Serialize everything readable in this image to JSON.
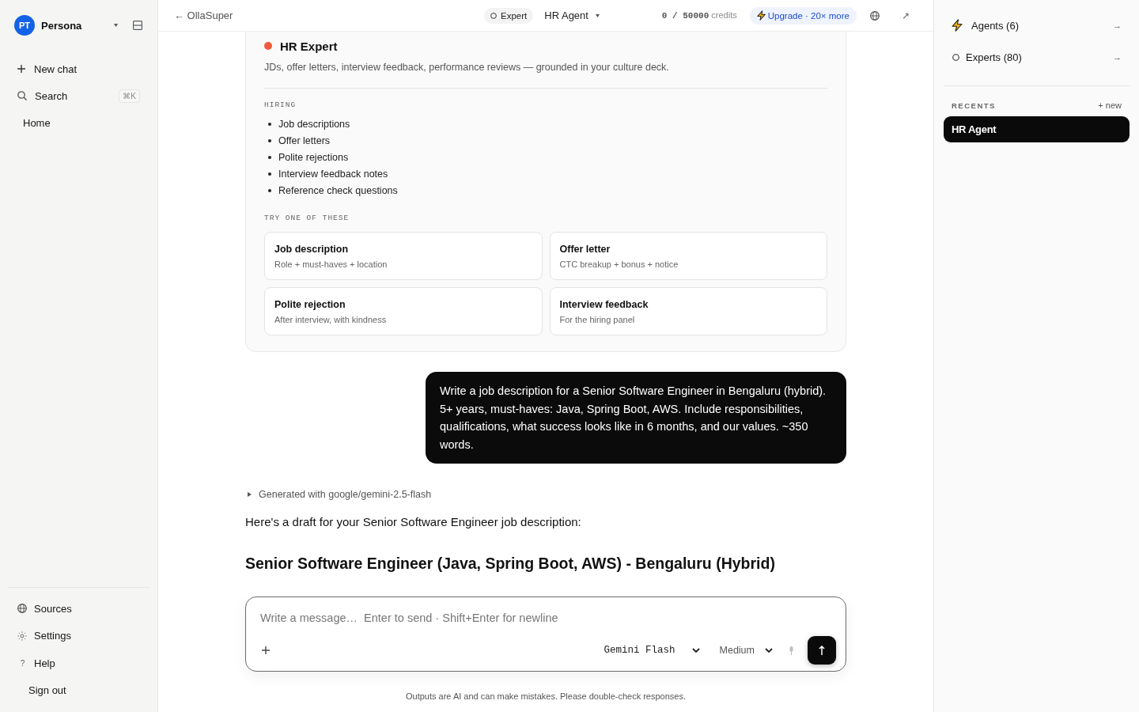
{
  "sidebar": {
    "account": {
      "initials": "PT",
      "name": "Persona"
    },
    "nav": [
      {
        "kind": "new",
        "label": "New chat"
      },
      {
        "kind": "search",
        "label": "Search",
        "shortcut": "⌘K"
      },
      {
        "kind": "link",
        "label": "Home"
      }
    ],
    "footer_nav": [
      {
        "kind": "sources",
        "label": "Sources"
      },
      {
        "kind": "settings",
        "label": "Settings"
      },
      {
        "kind": "help",
        "glyph": "?",
        "label": "Help"
      },
      {
        "kind": "link",
        "label": "Sign out"
      }
    ]
  },
  "top_bar": {
    "back_link": {
      "arrow": "←",
      "label": "OllaSuper"
    },
    "mode": {
      "label": "Expert"
    },
    "agent_select": {
      "label": "HR Agent"
    },
    "credits": {
      "amount": "0 / 50000",
      "unit": "credits"
    },
    "upgrade_button": {
      "label": "Upgrade · 20× more"
    },
    "open_button": {
      "glyph": "↗"
    }
  },
  "expert_card": {
    "name": "HR Expert",
    "description": "JDs, offer letters, interview feedback, performance reviews — grounded in your culture deck.",
    "sections": [
      {
        "heading": "HIRING",
        "items": [
          "Job descriptions",
          "Offer letters",
          "Polite rejections",
          "Interview feedback notes",
          "Reference check questions"
        ]
      }
    ],
    "suggestions_heading": "TRY ONE OF THESE",
    "suggestions": [
      {
        "title": "Job description",
        "subtitle": "Role + must-haves + location"
      },
      {
        "title": "Offer letter",
        "subtitle": "CTC breakup + bonus + notice"
      },
      {
        "title": "Polite rejection",
        "subtitle": "After interview, with kindness"
      },
      {
        "title": "Interview feedback",
        "subtitle": "For the hiring panel"
      }
    ]
  },
  "messages": [
    {
      "kind": "user",
      "text": "Write a job description for a Senior Software Engineer in Bengaluru (hybrid). 5+ years, must-haves: Java, Spring Boot, AWS. Include responsibilities, qualifications, what success looks like in 6 months, and our values. ~350 words."
    },
    {
      "kind": "assistant",
      "meta": "Generated with google/gemini-2.5-flash",
      "expanded": false,
      "intro": "Here's a draft for your Senior Software Engineer job description:",
      "heading": "Senior Software Engineer (Java, Spring Boot, AWS) - Bengaluru (Hybrid)"
    }
  ],
  "composer": {
    "placeholder": "Write a message…  Enter to send · Shift+Enter for newline",
    "model_select": {
      "value": "Gemini Flash"
    },
    "effort_select": {
      "value": "Medium"
    }
  },
  "disclaimer": "Outputs are AI and can make mistakes. Please double-check responses.",
  "right_panel": {
    "links": [
      {
        "kind": "agents",
        "label": "Agents (6)",
        "arrow": "→"
      },
      {
        "kind": "experts",
        "label": "Experts (80)",
        "arrow": "→"
      }
    ],
    "recents": {
      "heading": "RECENTS",
      "new_label": "+ new",
      "items": [
        {
          "label": "HR Agent",
          "selected": true
        }
      ]
    }
  }
}
